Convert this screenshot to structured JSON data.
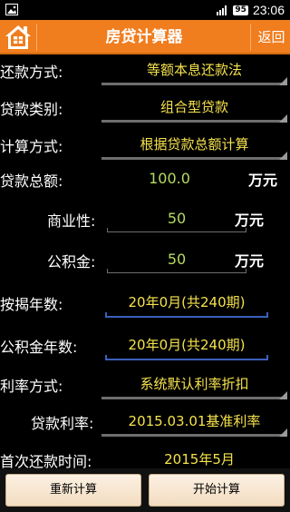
{
  "status_bar": {
    "battery": "95",
    "time": "23:06"
  },
  "header": {
    "title": "房贷计算器",
    "back_label": "返回"
  },
  "form": {
    "repay_method": {
      "label": "还款方式:",
      "value": "等额本息还款法"
    },
    "loan_type": {
      "label": "贷款类别:",
      "value": "组合型贷款"
    },
    "calc_method": {
      "label": "计算方式:",
      "value": "根据贷款总额计算"
    },
    "total_loan": {
      "label": "贷款总额:",
      "value": "100.0",
      "unit": "万元"
    },
    "commercial": {
      "label": "商业性:",
      "value": "50",
      "unit": "万元"
    },
    "provident": {
      "label": "公积金:",
      "value": "50",
      "unit": "万元"
    },
    "mortgage_years": {
      "label": "按揭年数:",
      "value": "20年0月(共240期)"
    },
    "provident_years": {
      "label": "公积金年数:",
      "value": "20年0月(共240期)"
    },
    "rate_method": {
      "label": "利率方式:",
      "value": "系统默认利率折扣"
    },
    "loan_rate": {
      "label": "贷款利率:",
      "value": "2015.03.01基准利率"
    },
    "first_repay": {
      "label": "首次还款时间:",
      "value": "2015年5月"
    }
  },
  "buttons": {
    "reset": "重新计算",
    "start": "开始计算"
  }
}
